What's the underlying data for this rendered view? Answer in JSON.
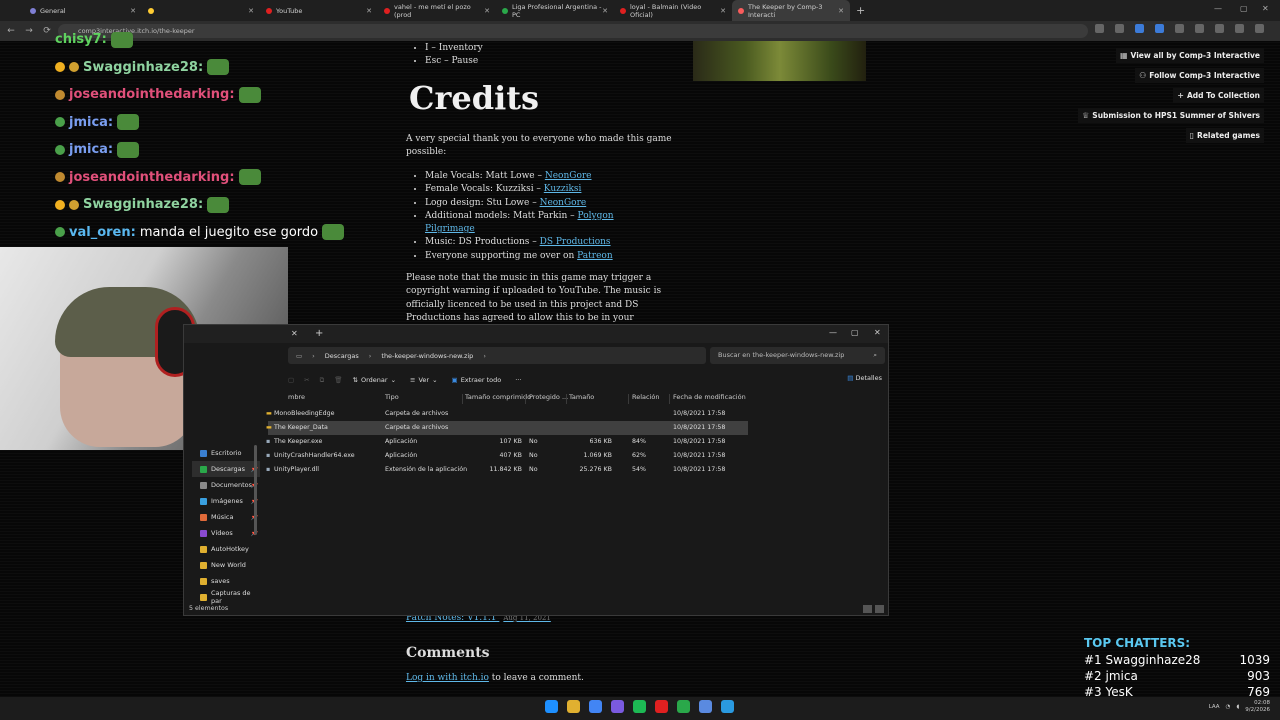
{
  "browser": {
    "tabs": [
      {
        "label": "General",
        "color": "#7f7fd5",
        "active": false
      },
      {
        "label": "",
        "color": "#ffcc33",
        "active": false
      },
      {
        "label": "YouTube",
        "color": "#e02020",
        "active": false
      },
      {
        "label": "vahel - me metí el pozo (prod",
        "color": "#e02020",
        "active": false
      },
      {
        "label": "Liga Profesional Argentina - PC",
        "color": "#2aa84a",
        "active": false
      },
      {
        "label": "loyal - Balmain (Video Oficial)",
        "color": "#e02020",
        "active": false
      },
      {
        "label": "The Keeper by Comp-3 Interacti",
        "color": "#fa5c5c",
        "active": true
      }
    ],
    "url": "comp3interactive.itch.io/the-keeper"
  },
  "page": {
    "controls": [
      "I – Inventory",
      "Esc – Pause"
    ],
    "credits_title": "Credits",
    "credits_intro": "A very special thank you to everyone who made this game possible:",
    "credits": [
      {
        "text": "Male Vocals: Matt Lowe – ",
        "link": "NeonGore"
      },
      {
        "text": "Female Vocals: Kuzziksi – ",
        "link": "Kuzziksi"
      },
      {
        "text": "Logo design: Stu Lowe – ",
        "link": "NeonGore"
      },
      {
        "text": "Additional models: Matt Parkin – ",
        "link": "Polygon Pilgrimage"
      },
      {
        "text": "Music: DS Productions – ",
        "link": "DS Productions"
      },
      {
        "text": "Everyone supporting me over on ",
        "link": "Patreon"
      }
    ],
    "music_note": "Please note that the music in this game may trigger a copyright warning if uploaded to YouTube. The music is officially licenced to be used in this project and DS Productions has agreed to allow this to be in your",
    "patch_notes": "Patch Notes: V1.1.1",
    "patch_date": "Aug 11, 2021",
    "comments_title": "Comments",
    "login_link": "Log in with itch.io",
    "login_suffix": " to leave a comment.",
    "side_links": [
      {
        "label": "View all by Comp-3 Interactive",
        "icon": "grid-icon"
      },
      {
        "label": "Follow Comp-3 Interactive",
        "icon": "person-plus-icon"
      },
      {
        "label": "Add To Collection",
        "icon": "plus-icon"
      },
      {
        "label": "Submission to HPS1 Summer of Shivers",
        "icon": "trophy-icon"
      },
      {
        "label": "Related games",
        "icon": "book-icon"
      }
    ]
  },
  "stream": {
    "chat": [
      {
        "user": "chisy7:",
        "color": "#5fd35f",
        "message": "",
        "badges": []
      },
      {
        "user": "Swagginhaze28:",
        "color": "#8fd3a0",
        "message": "",
        "badges": [
          "#f0b020",
          "#d0a030"
        ]
      },
      {
        "user": "joseandointhedarking:",
        "color": "#e0507a",
        "message": "",
        "badges": [
          "#c08a30"
        ]
      },
      {
        "user": "jmica:",
        "color": "#7a9ef0",
        "message": "",
        "badges": [
          "#4aa04a"
        ]
      },
      {
        "user": "jmica:",
        "color": "#7a9ef0",
        "message": "",
        "badges": [
          "#4aa04a"
        ]
      },
      {
        "user": "joseandointhedarking:",
        "color": "#e0507a",
        "message": "",
        "badges": [
          "#c08a30"
        ]
      },
      {
        "user": "Swagginhaze28:",
        "color": "#8fd3a0",
        "message": "",
        "badges": [
          "#f0b020",
          "#d0a030"
        ]
      },
      {
        "user": "val_oren:",
        "color": "#5ab8f0",
        "message": "manda el juegito ese gordo",
        "badges": [
          "#4aa04a"
        ]
      }
    ],
    "top_chatters_title": "TOP CHATTERS:",
    "top_chatters": [
      {
        "rank": "#1",
        "name": "Swagginhaze28",
        "count": "1039"
      },
      {
        "rank": "#2",
        "name": "jmica",
        "count": "903"
      },
      {
        "rank": "#3",
        "name": "YesK",
        "count": "769"
      }
    ]
  },
  "explorer": {
    "breadcrumb": [
      "Descargas",
      "the-keeper-windows-new.zip"
    ],
    "search_placeholder": "Buscar en the-keeper-windows-new.zip",
    "commands": {
      "sort": "Ordenar",
      "view": "Ver",
      "extract": "Extraer todo",
      "more": "···",
      "details": "Detalles"
    },
    "columns": {
      "name": "mbre",
      "type": "Tipo",
      "compressed": "Tamaño comprimido",
      "protected": "Protegido ...",
      "size": "Tamaño",
      "ratio": "Relación",
      "modified": "Fecha de modificación"
    },
    "files": [
      {
        "name": "MonoBleedingEdge",
        "type": "Carpeta de archivos",
        "compressed": "",
        "protected": "",
        "size": "",
        "ratio": "",
        "modified": "10/8/2021 17:58"
      },
      {
        "name": "The Keeper_Data",
        "type": "Carpeta de archivos",
        "compressed": "",
        "protected": "",
        "size": "",
        "ratio": "",
        "modified": "10/8/2021 17:58"
      },
      {
        "name": "The Keeper.exe",
        "type": "Aplicación",
        "compressed": "107 KB",
        "protected": "No",
        "size": "636 KB",
        "ratio": "84%",
        "modified": "10/8/2021 17:58"
      },
      {
        "name": "UnityCrashHandler64.exe",
        "type": "Aplicación",
        "compressed": "407 KB",
        "protected": "No",
        "size": "1.069 KB",
        "ratio": "62%",
        "modified": "10/8/2021 17:58"
      },
      {
        "name": "UnityPlayer.dll",
        "type": "Extensión de la aplicación",
        "compressed": "11.842 KB",
        "protected": "No",
        "size": "25.276 KB",
        "ratio": "54%",
        "modified": "10/8/2021 17:58"
      }
    ],
    "sidebar": [
      {
        "label": "Escritorio",
        "color": "#3a7fd0"
      },
      {
        "label": "Descargas",
        "color": "#2aa84a"
      },
      {
        "label": "Documentos",
        "color": "#8a8a8a"
      },
      {
        "label": "Imágenes",
        "color": "#3aa0e0"
      },
      {
        "label": "Música",
        "color": "#e06a3a"
      },
      {
        "label": "Vídeos",
        "color": "#8a4ad0"
      },
      {
        "label": "AutoHotkey",
        "color": "#e0b030"
      },
      {
        "label": "New World",
        "color": "#e0b030"
      },
      {
        "label": "saves",
        "color": "#e0b030"
      },
      {
        "label": "Capturas de par",
        "color": "#e0b030"
      }
    ],
    "status": "5 elementos"
  },
  "taskbar": {
    "apps": [
      "#1e90ff",
      "#e0b030",
      "#4285f4",
      "#7a5ae0",
      "#1db954",
      "#e02020",
      "#2aa84a",
      "#5a8ae0",
      "#2a9ae0"
    ],
    "lang": "LAA",
    "time": "02:08",
    "date": "9/2/2026"
  }
}
